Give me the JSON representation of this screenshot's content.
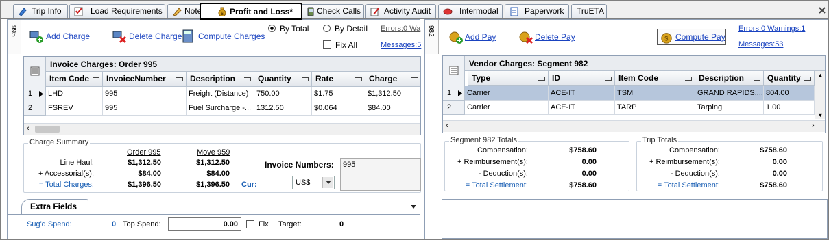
{
  "tabs": [
    {
      "label": "Trip Info",
      "icon": "pencil-blue-icon"
    },
    {
      "label": "Load Requirements",
      "icon": "checklist-icon"
    },
    {
      "label": "Notes",
      "icon": "pencil-icon"
    },
    {
      "label": "Profit and Loss*",
      "icon": "money-bag-icon",
      "active": true
    },
    {
      "label": "Check Calls",
      "icon": "phone-icon"
    },
    {
      "label": "Activity Audit",
      "icon": "audit-icon"
    },
    {
      "label": "Intermodal",
      "icon": "intermodal-icon"
    },
    {
      "label": "Paperwork",
      "icon": "paperwork-icon"
    },
    {
      "label": "TruETA",
      "icon": ""
    }
  ],
  "left": {
    "strip_label": "995",
    "toolbar": {
      "add_charge": "Add Charge",
      "delete_charge": "Delete Charge",
      "compute_charges": "Compute Charges",
      "by_total": "By Total",
      "by_detail": "By Detail",
      "fix_all": "Fix All",
      "errors": "Errors:0 Wa",
      "messages": "Messages:5"
    },
    "grid": {
      "title": "Invoice Charges: Order 995",
      "columns": [
        "Item Code",
        "InvoiceNumber",
        "Description",
        "Quantity",
        "Rate",
        "Charge"
      ],
      "rows": [
        {
          "num": "1",
          "cells": [
            "LHD",
            "995",
            "Freight (Distance)",
            "750.00",
            "$1.75",
            "$1,312.50"
          ]
        },
        {
          "num": "2",
          "cells": [
            "FSREV",
            "995",
            "Fuel Surcharge -...",
            "1312.50",
            "$0.064",
            "$84.00"
          ]
        }
      ]
    },
    "summary": {
      "legend": "Charge Summary",
      "col1": "Order 995",
      "col2": "Move 959",
      "line_haul_label": "Line Haul:",
      "line_haul": [
        "$1,312.50",
        "$1,312.50"
      ],
      "accessorial_label": "+ Accessorial(s):",
      "accessorial": [
        "$84.00",
        "$84.00"
      ],
      "total_label": "= Total Charges:",
      "total": [
        "$1,396.50",
        "$1,396.50"
      ],
      "invoice_numbers_label": "Invoice Numbers:",
      "invoice_numbers_value": "995",
      "cur_label": "Cur:",
      "cur_value": "US$"
    },
    "extra": {
      "tab": "Extra Fields",
      "sugd_label": "Sug'd Spend:",
      "sugd_value": "0",
      "top_label": "Top Spend:",
      "top_value": "0.00",
      "fix_label": "Fix",
      "target_label": "Target:",
      "target_value": "0"
    }
  },
  "right": {
    "strip_label": "982",
    "toolbar": {
      "add_pay": "Add Pay",
      "delete_pay": "Delete Pay",
      "compute_pay": "Compute Pay",
      "errors": "Errors:0 Warnings:1",
      "messages": "Messages:53"
    },
    "grid": {
      "title": "Vendor Charges: Segment 982",
      "columns": [
        "Type",
        "ID",
        "Item Code",
        "Description",
        "Quantity"
      ],
      "rows": [
        {
          "num": "1",
          "cells": [
            "Carrier",
            "ACE-IT",
            "TSM",
            "GRAND RAPIDS,...",
            "804.00"
          ]
        },
        {
          "num": "2",
          "cells": [
            "Carrier",
            "ACE-IT",
            "TARP",
            "Tarping",
            "1.00"
          ]
        }
      ]
    },
    "segment": {
      "legend": "Segment 982 Totals",
      "comp_label": "Compensation:",
      "comp": "$758.60",
      "reimb_label": "+ Reimbursement(s):",
      "reimb": "0.00",
      "ded_label": "- Deduction(s):",
      "ded": "0.00",
      "total_label": "= Total Settlement:",
      "total": "$758.60"
    },
    "trip": {
      "legend": "Trip Totals",
      "comp_label": "Compensation:",
      "comp": "$758.60",
      "reimb_label": "+ Reimbursement(s):",
      "reimb": "0.00",
      "ded_label": "- Deduction(s):",
      "ded": "0.00",
      "total_label": "= Total Settlement:",
      "total": "$758.60"
    }
  },
  "colors": {
    "link": "#1a43c0",
    "selected_row": "#b6c6dc",
    "total_blue": "#1a5fb4"
  }
}
